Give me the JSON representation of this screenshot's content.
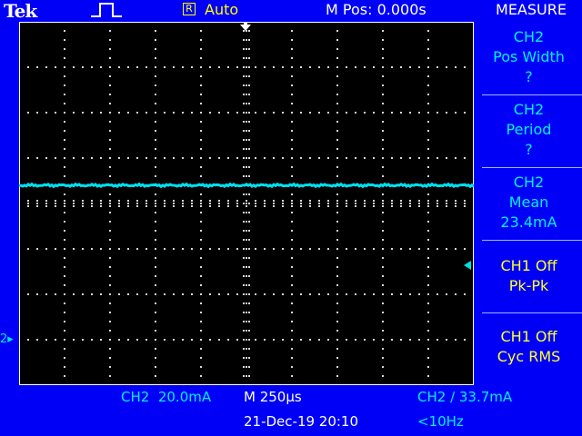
{
  "header": {
    "brand": "Tek",
    "acquisition_icon": "pulse-icon",
    "trigger_status_letter": "R",
    "trigger_mode": "Auto",
    "horizontal_position": "M Pos: 0.000s",
    "menu_title": "MEASURE"
  },
  "measure_menu": {
    "items": [
      {
        "line1": "CH2",
        "line2": "Pos Width",
        "line3": "?"
      },
      {
        "line1": "CH2",
        "line2": "Period",
        "line3": "?"
      },
      {
        "line1": "CH2",
        "line2": "Mean",
        "line3": "23.4mA"
      },
      {
        "line1": "CH1 Off",
        "line2": "Pk-Pk"
      },
      {
        "line1": "CH1 Off",
        "line2": "Cyc RMS"
      }
    ]
  },
  "display": {
    "channel_ground_label": "2",
    "trace_color": "#00e0f0",
    "trace_level_divisions": 2.2
  },
  "status_bar": {
    "ch2_scale": "CH2  20.0mA",
    "timebase": "M 250µs",
    "trigger": "CH2 ∕ 33.7mA",
    "datetime": "21-Dec-19 20:10",
    "frequency": "<10Hz"
  },
  "colors": {
    "background": "#0000f6",
    "graticule": "#000000",
    "ch2": "#00f0ff",
    "trigger": "#ffff00"
  }
}
